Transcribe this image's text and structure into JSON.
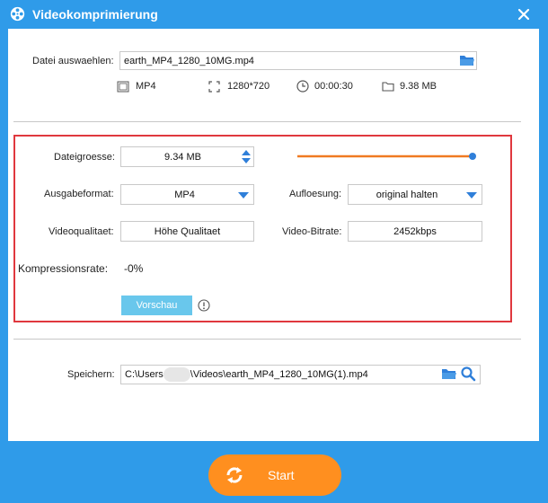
{
  "window": {
    "title": "Videokomprimierung",
    "accent_color": "#2f9be9",
    "highlight_color": "#e0383e",
    "slider_color": "#f07a22",
    "start_color": "#ff8f1f"
  },
  "source": {
    "label": "Datei auswaehlen:",
    "file_value": "earth_MP4_1280_10MG.mp4",
    "info": {
      "format": "MP4",
      "resolution": "1280*720",
      "duration": "00:00:30",
      "size": "9.38 MB"
    }
  },
  "settings": {
    "filesize_label": "Dateigroesse:",
    "filesize_value": "9.34 MB",
    "filesize_slider_fraction": 1.0,
    "format_label": "Ausgabeformat:",
    "format_value": "MP4",
    "resolution_label": "Aufloesung:",
    "resolution_value": "original halten",
    "quality_label": "Videoqualitaet:",
    "quality_value": "Höhe Qualitaet",
    "bitrate_label": "Video-Bitrate:",
    "bitrate_value": "2452kbps",
    "compression_label": "Kompressionsrate:",
    "compression_value": "-0%",
    "preview_label": "Vorschau"
  },
  "save": {
    "label": "Speichern:",
    "path_prefix": "C:\\Users",
    "path_suffix": "\\Videos\\earth_MP4_1280_10MG(1).mp4"
  },
  "actions": {
    "start_label": "Start"
  }
}
